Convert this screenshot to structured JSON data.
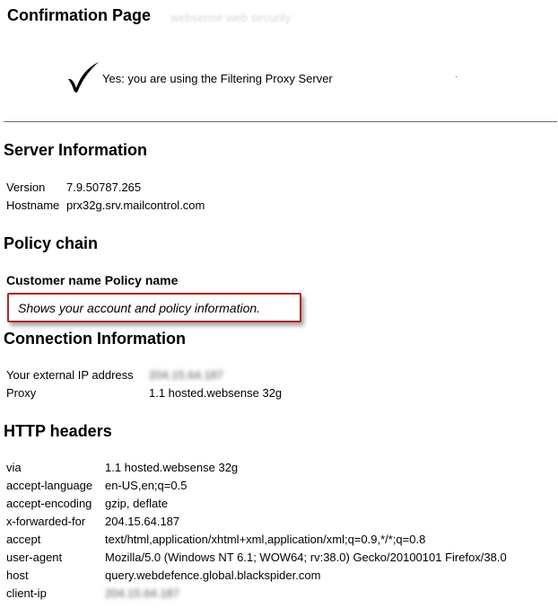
{
  "page": {
    "title": "Confirmation Page",
    "faint_title": "websense web security",
    "check_icon": "checkmark-icon",
    "status": "Yes: you are using the Filtering Proxy Server",
    "status_dot": "·"
  },
  "server": {
    "heading": "Server Information",
    "version_label": "Version",
    "version_value": "7.9.50787.265",
    "hostname_label": "Hostname",
    "hostname_value": "prx32g.srv.mailcontrol.com"
  },
  "policy": {
    "heading": "Policy chain",
    "columns": "Customer name Policy name",
    "callout": "Shows your account and policy information."
  },
  "connection": {
    "heading": "Connection Information",
    "ip_label": "Your external IP address",
    "ip_value": "204.15.64.187",
    "proxy_label": "Proxy",
    "proxy_value": "1.1 hosted.websense 32g"
  },
  "http": {
    "heading": "HTTP headers",
    "rows": [
      {
        "key": "via",
        "value": "1.1 hosted.websense 32g"
      },
      {
        "key": "accept-language",
        "value": "en-US,en;q=0.5"
      },
      {
        "key": "accept-encoding",
        "value": "gzip, deflate"
      },
      {
        "key": "x-forwarded-for",
        "value": "204.15.64.187"
      },
      {
        "key": "accept",
        "value": "text/html,application/xhtml+xml,application/xml;q=0.9,*/*;q=0.8"
      },
      {
        "key": "user-agent",
        "value": "Mozilla/5.0 (Windows NT 6.1; WOW64; rv:38.0) Gecko/20100101 Firefox/38.0"
      },
      {
        "key": "host",
        "value": "query.webdefence.global.blackspider.com"
      },
      {
        "key": "client-ip",
        "value": "204.15.64.187"
      }
    ]
  }
}
